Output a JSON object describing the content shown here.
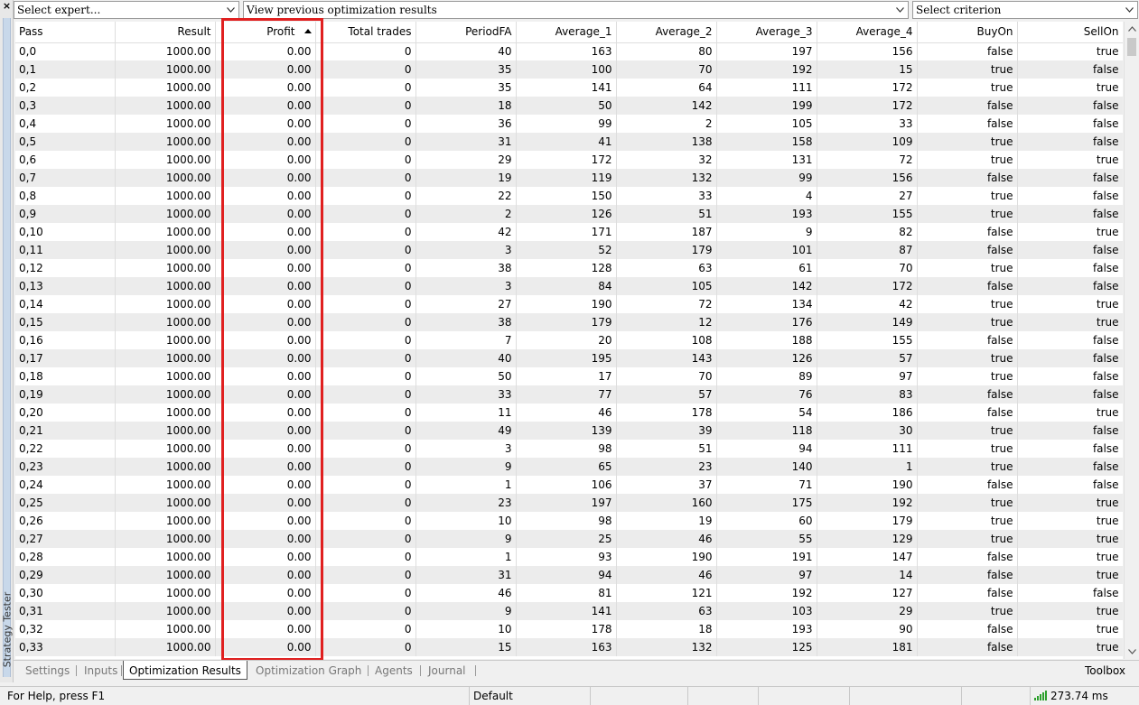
{
  "side_panel": {
    "title": "Strategy Tester",
    "close_glyph": "×"
  },
  "toolbar": {
    "expert_placeholder": "Select expert...",
    "results_placeholder": "View previous optimization results",
    "criterion_placeholder": "Select criterion"
  },
  "columns": [
    "Pass",
    "Result",
    "Profit",
    "Total trades",
    "PeriodFA",
    "Average_1",
    "Average_2",
    "Average_3",
    "Average_4",
    "BuyOn",
    "SellOn"
  ],
  "sorted_column": "Profit",
  "rows": [
    [
      "0,0",
      "1000.00",
      "0.00",
      "0",
      "40",
      "163",
      "80",
      "197",
      "156",
      "false",
      "true"
    ],
    [
      "0,1",
      "1000.00",
      "0.00",
      "0",
      "35",
      "100",
      "70",
      "192",
      "15",
      "true",
      "false"
    ],
    [
      "0,2",
      "1000.00",
      "0.00",
      "0",
      "35",
      "141",
      "64",
      "111",
      "172",
      "true",
      "true"
    ],
    [
      "0,3",
      "1000.00",
      "0.00",
      "0",
      "18",
      "50",
      "142",
      "199",
      "172",
      "false",
      "false"
    ],
    [
      "0,4",
      "1000.00",
      "0.00",
      "0",
      "36",
      "99",
      "2",
      "105",
      "33",
      "false",
      "false"
    ],
    [
      "0,5",
      "1000.00",
      "0.00",
      "0",
      "31",
      "41",
      "138",
      "158",
      "109",
      "true",
      "false"
    ],
    [
      "0,6",
      "1000.00",
      "0.00",
      "0",
      "29",
      "172",
      "32",
      "131",
      "72",
      "true",
      "true"
    ],
    [
      "0,7",
      "1000.00",
      "0.00",
      "0",
      "19",
      "119",
      "132",
      "99",
      "156",
      "false",
      "false"
    ],
    [
      "0,8",
      "1000.00",
      "0.00",
      "0",
      "22",
      "150",
      "33",
      "4",
      "27",
      "true",
      "false"
    ],
    [
      "0,9",
      "1000.00",
      "0.00",
      "0",
      "2",
      "126",
      "51",
      "193",
      "155",
      "true",
      "false"
    ],
    [
      "0,10",
      "1000.00",
      "0.00",
      "0",
      "42",
      "171",
      "187",
      "9",
      "82",
      "false",
      "true"
    ],
    [
      "0,11",
      "1000.00",
      "0.00",
      "0",
      "3",
      "52",
      "179",
      "101",
      "87",
      "false",
      "false"
    ],
    [
      "0,12",
      "1000.00",
      "0.00",
      "0",
      "38",
      "128",
      "63",
      "61",
      "70",
      "true",
      "false"
    ],
    [
      "0,13",
      "1000.00",
      "0.00",
      "0",
      "3",
      "84",
      "105",
      "142",
      "172",
      "false",
      "false"
    ],
    [
      "0,14",
      "1000.00",
      "0.00",
      "0",
      "27",
      "190",
      "72",
      "134",
      "42",
      "true",
      "true"
    ],
    [
      "0,15",
      "1000.00",
      "0.00",
      "0",
      "38",
      "179",
      "12",
      "176",
      "149",
      "true",
      "true"
    ],
    [
      "0,16",
      "1000.00",
      "0.00",
      "0",
      "7",
      "20",
      "108",
      "188",
      "155",
      "false",
      "false"
    ],
    [
      "0,17",
      "1000.00",
      "0.00",
      "0",
      "40",
      "195",
      "143",
      "126",
      "57",
      "true",
      "false"
    ],
    [
      "0,18",
      "1000.00",
      "0.00",
      "0",
      "50",
      "17",
      "70",
      "89",
      "97",
      "true",
      "false"
    ],
    [
      "0,19",
      "1000.00",
      "0.00",
      "0",
      "33",
      "77",
      "57",
      "76",
      "83",
      "false",
      "false"
    ],
    [
      "0,20",
      "1000.00",
      "0.00",
      "0",
      "11",
      "46",
      "178",
      "54",
      "186",
      "false",
      "true"
    ],
    [
      "0,21",
      "1000.00",
      "0.00",
      "0",
      "49",
      "139",
      "39",
      "118",
      "30",
      "true",
      "false"
    ],
    [
      "0,22",
      "1000.00",
      "0.00",
      "0",
      "3",
      "98",
      "51",
      "94",
      "111",
      "true",
      "false"
    ],
    [
      "0,23",
      "1000.00",
      "0.00",
      "0",
      "9",
      "65",
      "23",
      "140",
      "1",
      "true",
      "false"
    ],
    [
      "0,24",
      "1000.00",
      "0.00",
      "0",
      "1",
      "106",
      "37",
      "71",
      "190",
      "false",
      "false"
    ],
    [
      "0,25",
      "1000.00",
      "0.00",
      "0",
      "23",
      "197",
      "160",
      "175",
      "192",
      "true",
      "true"
    ],
    [
      "0,26",
      "1000.00",
      "0.00",
      "0",
      "10",
      "98",
      "19",
      "60",
      "179",
      "true",
      "true"
    ],
    [
      "0,27",
      "1000.00",
      "0.00",
      "0",
      "9",
      "25",
      "46",
      "55",
      "129",
      "true",
      "true"
    ],
    [
      "0,28",
      "1000.00",
      "0.00",
      "0",
      "1",
      "93",
      "190",
      "191",
      "147",
      "false",
      "true"
    ],
    [
      "0,29",
      "1000.00",
      "0.00",
      "0",
      "31",
      "94",
      "46",
      "97",
      "14",
      "false",
      "true"
    ],
    [
      "0,30",
      "1000.00",
      "0.00",
      "0",
      "46",
      "81",
      "121",
      "192",
      "127",
      "false",
      "false"
    ],
    [
      "0,31",
      "1000.00",
      "0.00",
      "0",
      "9",
      "141",
      "63",
      "103",
      "29",
      "true",
      "true"
    ],
    [
      "0,32",
      "1000.00",
      "0.00",
      "0",
      "10",
      "178",
      "18",
      "193",
      "90",
      "false",
      "true"
    ],
    [
      "0,33",
      "1000.00",
      "0.00",
      "0",
      "15",
      "163",
      "132",
      "125",
      "181",
      "false",
      "true"
    ]
  ],
  "tabs": [
    {
      "label": "Settings",
      "active": false
    },
    {
      "label": "Inputs",
      "active": false
    },
    {
      "label": "Optimization Results",
      "active": true
    },
    {
      "label": "Optimization Graph",
      "active": false
    },
    {
      "label": "Agents",
      "active": false
    },
    {
      "label": "Journal",
      "active": false
    }
  ],
  "toolbox_label": "Toolbox",
  "status_bar": {
    "help": "For Help, press F1",
    "profile": "Default",
    "ping": "273.74 ms"
  },
  "colors": {
    "highlight": "#e02020",
    "alt_row": "#ececec",
    "signal": "#2ca02c"
  }
}
